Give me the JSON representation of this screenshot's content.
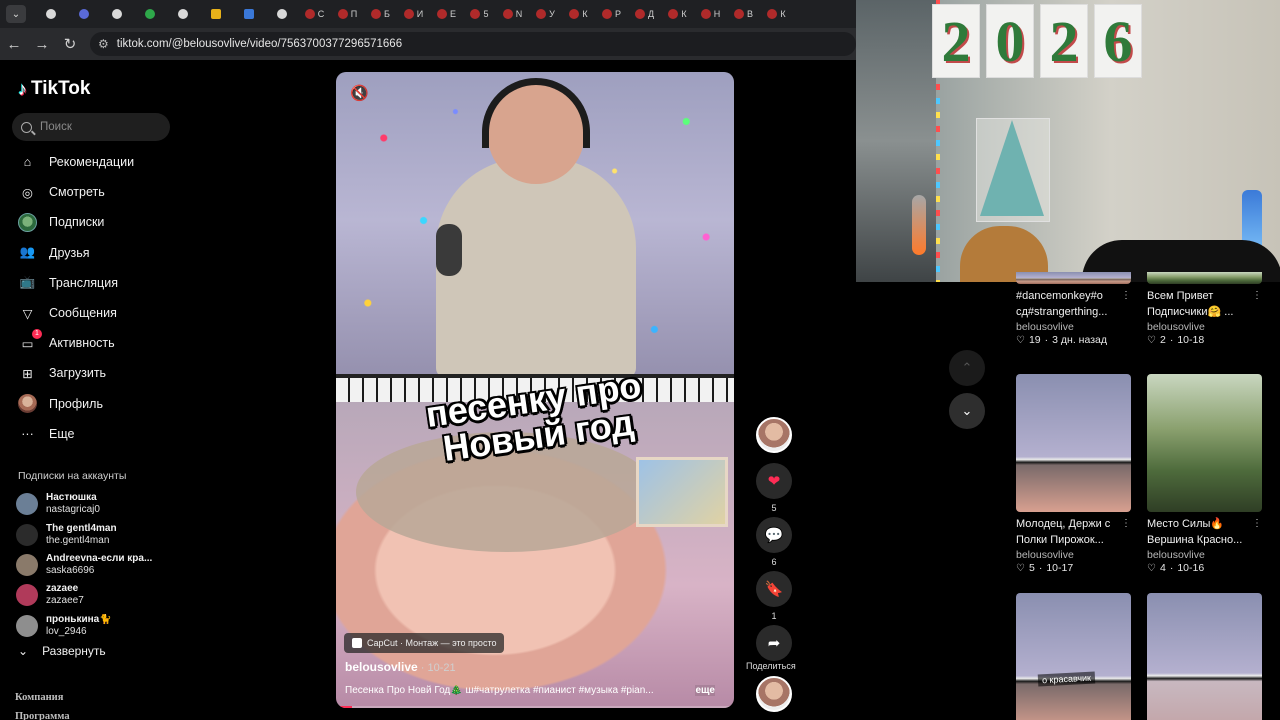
{
  "browser": {
    "url": "tiktok.com/@belousovlive/video/7563700377296571666",
    "tabs": [
      {
        "fav": "w",
        "letter": ""
      },
      {
        "fav": "p",
        "letter": ""
      },
      {
        "fav": "w",
        "letter": ""
      },
      {
        "fav": "g",
        "letter": ""
      },
      {
        "fav": "w",
        "letter": ""
      },
      {
        "fav": "y",
        "letter": ""
      },
      {
        "fav": "b",
        "letter": ""
      },
      {
        "fav": "w",
        "letter": ""
      },
      {
        "fav": "r",
        "letter": "С"
      },
      {
        "fav": "r",
        "letter": "П"
      },
      {
        "fav": "r",
        "letter": "Б"
      },
      {
        "fav": "r",
        "letter": "И"
      },
      {
        "fav": "r",
        "letter": "Е"
      },
      {
        "fav": "r",
        "letter": "5"
      },
      {
        "fav": "r",
        "letter": "N"
      },
      {
        "fav": "r",
        "letter": "У"
      },
      {
        "fav": "r",
        "letter": "К"
      },
      {
        "fav": "r",
        "letter": "Р"
      },
      {
        "fav": "r",
        "letter": "Д"
      },
      {
        "fav": "r",
        "letter": "К"
      },
      {
        "fav": "r",
        "letter": "Н"
      },
      {
        "fav": "r",
        "letter": "В"
      },
      {
        "fav": "r",
        "letter": "К"
      }
    ]
  },
  "sidebar": {
    "logo": "TikTok",
    "search_placeholder": "Поиск",
    "nav": [
      {
        "label": "Рекомендации",
        "icon": "home-icon",
        "glyph": "⌂"
      },
      {
        "label": "Смотреть",
        "icon": "compass-icon",
        "glyph": "◎"
      },
      {
        "label": "Подписки",
        "icon": "following-avatar-icon",
        "glyph": ""
      },
      {
        "label": "Друзья",
        "icon": "friends-icon",
        "glyph": "👥"
      },
      {
        "label": "Трансляция",
        "icon": "live-tv-icon",
        "glyph": "📺"
      },
      {
        "label": "Сообщения",
        "icon": "messages-icon",
        "glyph": "▽"
      },
      {
        "label": "Активность",
        "icon": "activity-icon",
        "glyph": "▭",
        "badge": "1"
      },
      {
        "label": "Загрузить",
        "icon": "upload-icon",
        "glyph": "⊞"
      },
      {
        "label": "Профиль",
        "icon": "profile-avatar-icon",
        "glyph": ""
      },
      {
        "label": "Еще",
        "icon": "more-icon",
        "glyph": "···"
      }
    ],
    "subs_title": "Подписки на аккаунты",
    "accounts": [
      {
        "name": "Настюшка",
        "handle": "nastagricaj0",
        "color": "#6b7f96"
      },
      {
        "name": "The gentl4man",
        "handle": "the.gentl4man",
        "color": "#2b2b2b"
      },
      {
        "name": "Andreevna-если кра...",
        "handle": "saska6696",
        "color": "#8a7a6a"
      },
      {
        "name": "zazaee",
        "handle": "zazaee7",
        "color": "#b03a5a"
      },
      {
        "name": "пронькина🐈",
        "handle": "lov_2946",
        "color": "#8e8e8e"
      }
    ],
    "expand_label": "Развернуть",
    "footer": [
      "Компания",
      "Программа"
    ]
  },
  "video": {
    "caption_line1": "песенку про",
    "caption_line2": "Новый год",
    "capcut": "CapCut · Монтаж — это просто",
    "author": "belousovlive",
    "date": "10-21",
    "description": "Песенка Про Новй Год🎄 ш#чатрулетка #пианист #музыка #pian...",
    "more": "еще",
    "progress": 0.04
  },
  "actions": {
    "likes": "5",
    "comments": "6",
    "saves": "1",
    "share_label": "Поделиться"
  },
  "webcam": {
    "year_digits": [
      "2",
      "0",
      "2",
      "6"
    ]
  },
  "grid": [
    {
      "title1": "#dancemonkey#o",
      "title2": "сд#strangerthing...",
      "author": "belousovlive",
      "likes": "19",
      "date": "3 дн. назад",
      "thumb": "th-a",
      "overlay": ""
    },
    {
      "title1": "Всем Привет",
      "title2": "Подписчики🤗 ...",
      "author": "belousovlive",
      "likes": "2",
      "date": "10-18",
      "thumb": "th-b",
      "overlay": ""
    },
    {
      "title1": "Молодец, Держи с",
      "title2": "Полки Пирожок...",
      "author": "belousovlive",
      "likes": "5",
      "date": "10-17",
      "thumb": "th-c",
      "overlay": ""
    },
    {
      "title1": "Место Силы🔥",
      "title2": "Вершина Красно...",
      "author": "belousovlive",
      "likes": "4",
      "date": "10-16",
      "thumb": "th-b",
      "overlay": ""
    },
    {
      "title1": "",
      "title2": "",
      "author": "",
      "likes": "",
      "date": "",
      "thumb": "th-c",
      "overlay": "о красавчик"
    },
    {
      "title1": "",
      "title2": "",
      "author": "",
      "likes": "",
      "date": "",
      "thumb": "th-d",
      "overlay": ""
    }
  ]
}
